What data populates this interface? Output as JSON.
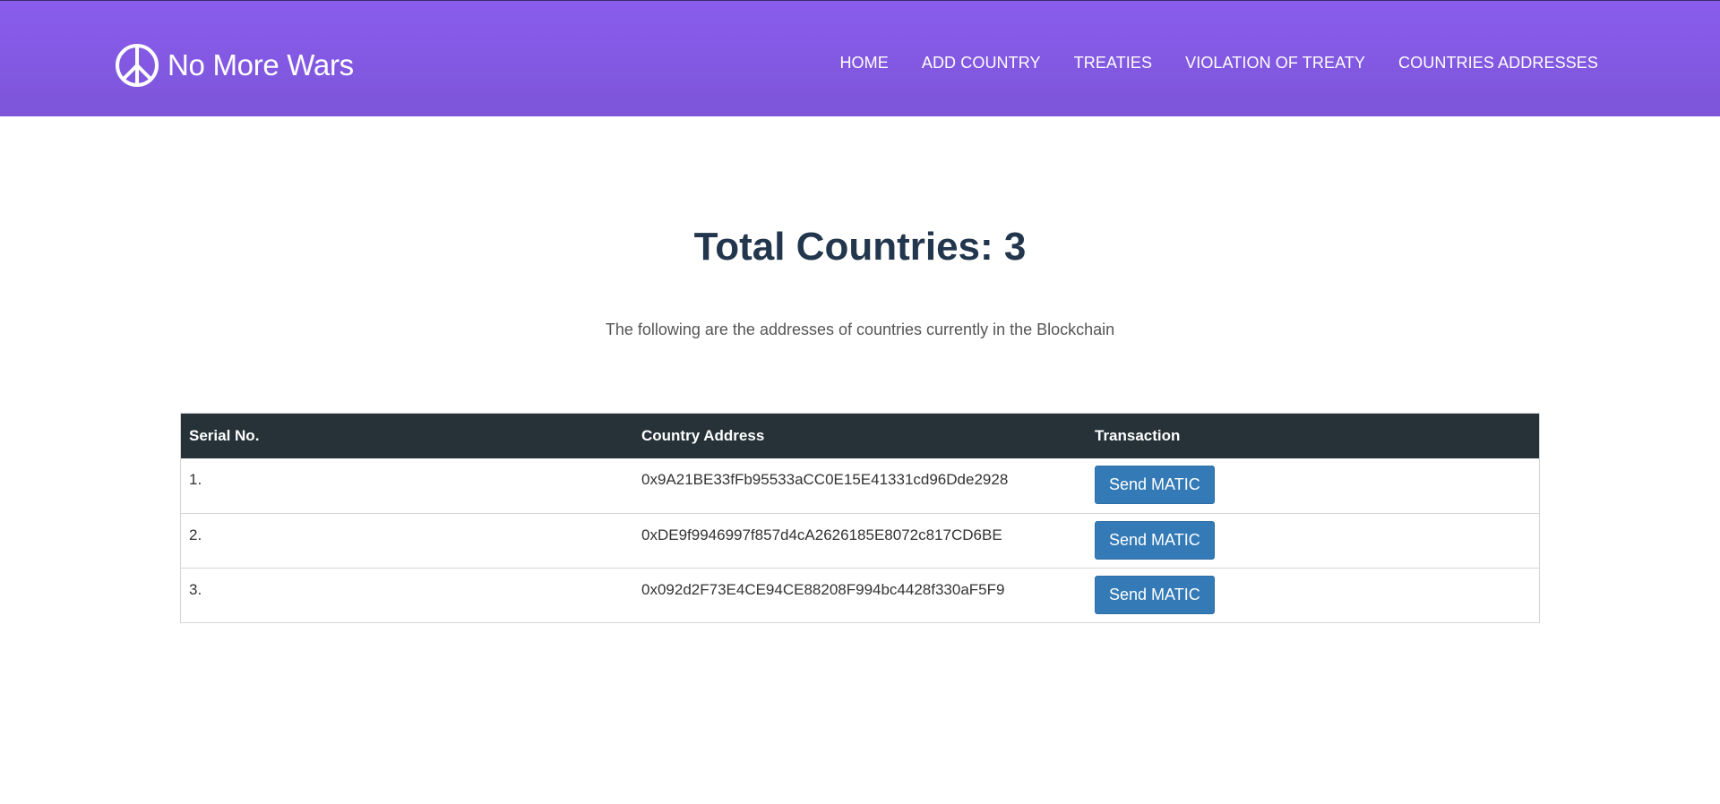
{
  "brand": {
    "icon": "peace-sign-icon",
    "name": "No More Wars"
  },
  "nav": {
    "items": [
      {
        "label": "HOME"
      },
      {
        "label": "ADD COUNTRY"
      },
      {
        "label": "TREATIES"
      },
      {
        "label": "VIOLATION OF TREATY"
      },
      {
        "label": "COUNTRIES ADDRESSES"
      }
    ]
  },
  "main": {
    "title": "Total Countries: 3",
    "subtitle": "The following are the addresses of countries currently in the Blockchain"
  },
  "table": {
    "headers": [
      "Serial No.",
      "Country Address",
      "Transaction"
    ],
    "rows": [
      {
        "serial": "1.",
        "address": "0x9A21BE33fFb95533aCC0E15E41331cd96Dde2928",
        "action": "Send MATIC"
      },
      {
        "serial": "2.",
        "address": "0xDE9f9946997f857d4cA2626185E8072c817CD6BE",
        "action": "Send MATIC"
      },
      {
        "serial": "3.",
        "address": "0x092d2F73E4CE94CE88208F994bc4428f330aF5F9",
        "action": "Send MATIC"
      }
    ]
  },
  "colors": {
    "header_gradient_top": "#8a5ded",
    "header_gradient_bottom": "#7c55d9",
    "title": "#22364d",
    "table_header": "#263238",
    "button": "#337ab7"
  }
}
